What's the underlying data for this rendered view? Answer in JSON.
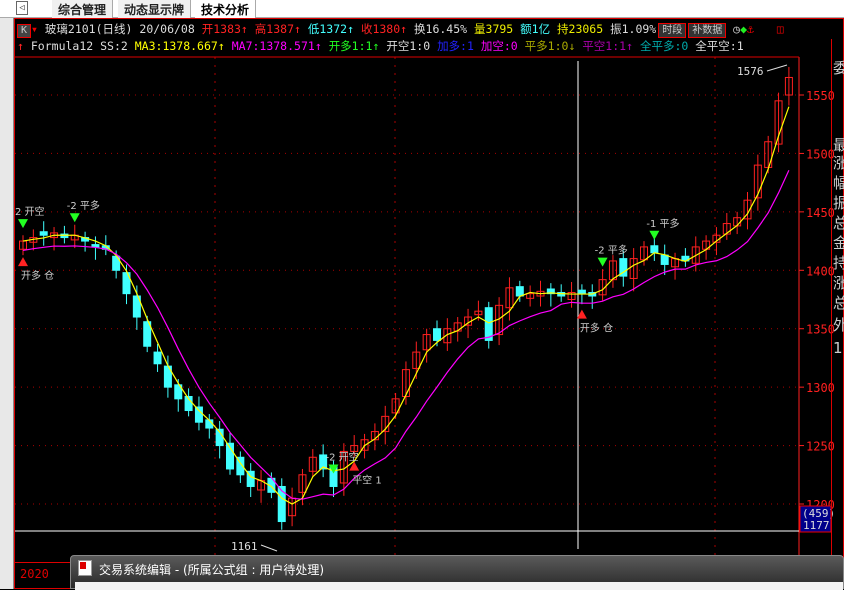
{
  "tabs": [
    "综合管理",
    "动态显示牌",
    "技术分析"
  ],
  "header": {
    "k_label": "K",
    "symbol": "玻璃2101(日线)",
    "date": "20/06/08",
    "open": "开1383",
    "high": "高1387",
    "low": "低1372",
    "close": "收1380",
    "turnover": "换16.45%",
    "volume": "量3795",
    "amount": "额1亿",
    "oi": "持23065",
    "amplitude": "振1.09%",
    "btn_period": "时段",
    "btn_fill": "补数据"
  },
  "formula": {
    "name": "Formula12 SS:2",
    "ma3": "MA3:1378.667",
    "ma7": "MA7:1378.571",
    "kd": "开多1:1",
    "kk": "开空1:0",
    "jd": "加多:1",
    "jk": "加空:0",
    "pd": "平多1:0",
    "pk": "平空1:1",
    "qpd": "全平多:0",
    "qpk": "全平空:1"
  },
  "colors": {
    "up": "#ff2020",
    "down": "#40ffff",
    "ma3": "#ffff00",
    "ma7": "#ff00ff",
    "axis": "#ff2020"
  },
  "axis": {
    "ticks": [
      1550,
      1500,
      1450,
      1400,
      1350,
      1300,
      1250,
      1200
    ],
    "cursor_count": "(459)",
    "cursor_price": "1177",
    "max_label": "1576",
    "min_label": "1161",
    "year": "2020"
  },
  "right_panel": [
    "委",
    "最",
    "涨",
    "幅",
    "振",
    "总",
    "金",
    "持",
    "涨",
    "总",
    "外",
    "1"
  ],
  "chart_data": {
    "type": "candlestick",
    "close": [
      1425,
      1428,
      1430,
      1432,
      1428,
      1430,
      1425,
      1420,
      1418,
      1400,
      1380,
      1360,
      1335,
      1320,
      1300,
      1290,
      1280,
      1270,
      1265,
      1250,
      1230,
      1225,
      1215,
      1220,
      1210,
      1185,
      1205,
      1225,
      1240,
      1230,
      1215,
      1245,
      1250,
      1255,
      1262,
      1275,
      1290,
      1315,
      1330,
      1345,
      1340,
      1350,
      1355,
      1360,
      1365,
      1340,
      1370,
      1385,
      1378,
      1380,
      1382,
      1380,
      1378,
      1381,
      1380,
      1378,
      1392,
      1408,
      1395,
      1410,
      1420,
      1415,
      1405,
      1410,
      1408,
      1420,
      1425,
      1430,
      1440,
      1445,
      1460,
      1490,
      1510,
      1545,
      1565
    ],
    "open": [
      1418,
      1424,
      1433,
      1428,
      1431,
      1426,
      1428,
      1422,
      1421,
      1412,
      1398,
      1378,
      1356,
      1330,
      1318,
      1302,
      1292,
      1283,
      1272,
      1264,
      1252,
      1240,
      1228,
      1212,
      1222,
      1215,
      1190,
      1210,
      1228,
      1242,
      1232,
      1218,
      1245,
      1246,
      1255,
      1262,
      1278,
      1292,
      1316,
      1332,
      1350,
      1338,
      1348,
      1353,
      1362,
      1368,
      1345,
      1368,
      1386,
      1376,
      1378,
      1384,
      1381,
      1375,
      1383,
      1381,
      1379,
      1392,
      1410,
      1393,
      1409,
      1421,
      1413,
      1403,
      1412,
      1406,
      1418,
      1424,
      1431,
      1438,
      1444,
      1462,
      1488,
      1508,
      1550
    ],
    "signals": [
      {
        "i": 0,
        "text": "2 开空",
        "pos": "above",
        "arrow": "down-green"
      },
      {
        "i": 5,
        "text": "-2 平多",
        "pos": "above",
        "arrow": "down-green"
      },
      {
        "i": 0,
        "text": "开多 仓",
        "pos": "below",
        "arrow": "up-red"
      },
      {
        "i": 30,
        "text": "-2 开空",
        "pos": "above",
        "arrow": "down-green"
      },
      {
        "i": 32,
        "text": "平空 1",
        "pos": "below",
        "arrow": "up-red"
      },
      {
        "i": 56,
        "text": "-2 平多",
        "pos": "above",
        "arrow": "down-green"
      },
      {
        "i": 54,
        "text": "开多 仓",
        "pos": "below",
        "arrow": "up-red"
      },
      {
        "i": 61,
        "text": "-1 平多",
        "pos": "above",
        "arrow": "down-green"
      }
    ]
  }
}
